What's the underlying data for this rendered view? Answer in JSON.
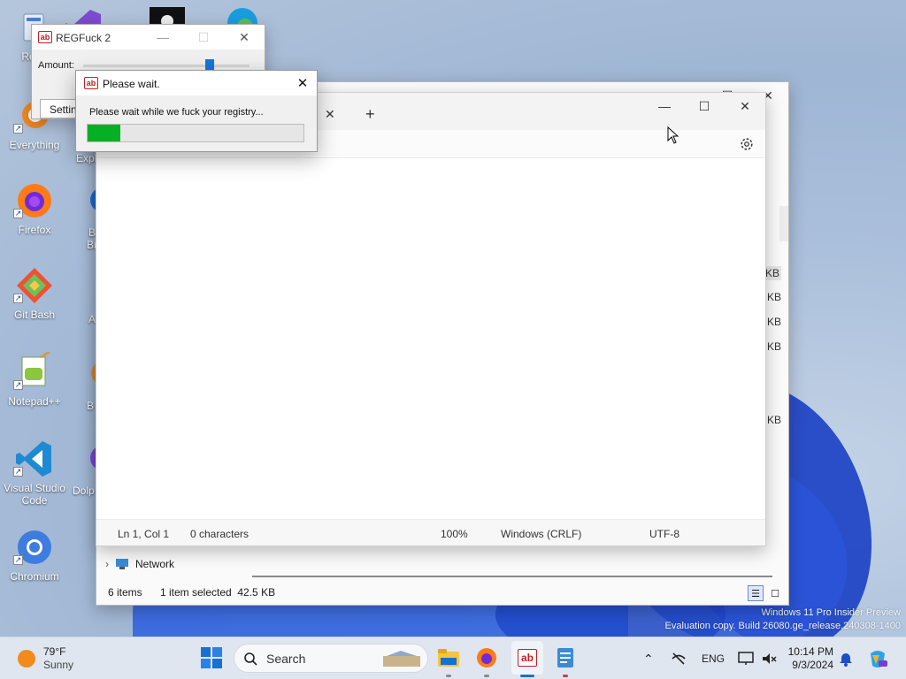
{
  "desktop": {
    "icons": [
      {
        "label": "Recy"
      },
      {
        "label": "Everything"
      },
      {
        "label": "Firefox"
      },
      {
        "label": "Git Bash"
      },
      {
        "label": "Notepad++"
      },
      {
        "label": "Visual Studio Code"
      },
      {
        "label": "Chromium"
      },
      {
        "label": "Expl"
      },
      {
        "label": "B Br"
      },
      {
        "label": "A"
      },
      {
        "label": "B"
      },
      {
        "label": "Dolp"
      }
    ],
    "watermark_line1": "Windows 11 Pro Insider Preview",
    "watermark_line2": "Evaluation copy. Build 26080.ge_release.240308-1400"
  },
  "regfuck": {
    "title": "REGFuck 2",
    "amount_label": "Amount:",
    "amount_level": 0.76,
    "settings_label": "Settings"
  },
  "please_wait": {
    "title": "Please wait.",
    "message": "Please wait while we fuck your registry...",
    "progress": 0.15
  },
  "notepad": {
    "tab_close": "✕",
    "tab_add": "+",
    "status": {
      "position": "Ln 1, Col 1",
      "chars": "0 characters",
      "zoom": "100%",
      "line_endings": "Windows (CRLF)",
      "encoding": "UTF-8"
    }
  },
  "explorer": {
    "nav_network": "Network",
    "item_count": "6 items",
    "selection": "1 item selected  42.5 KB",
    "size_suffixes": [
      "KB",
      "KB",
      "KB",
      "KB",
      "KB"
    ]
  },
  "taskbar": {
    "weather_temp": "79°F",
    "weather_desc": "Sunny",
    "search_placeholder": "Search",
    "language": "ENG",
    "time": "10:14 PM",
    "date": "9/3/2024"
  },
  "colors": {
    "progress_fill": "#06b025",
    "accent": "#1a6fd1"
  }
}
